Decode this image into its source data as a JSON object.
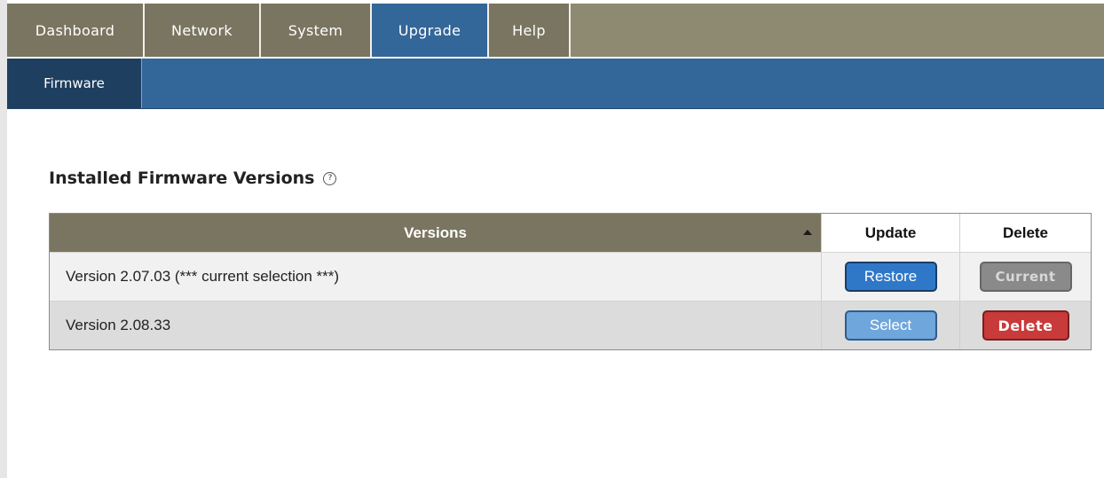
{
  "nav": {
    "tabs": [
      "Dashboard",
      "Network",
      "System",
      "Upgrade",
      "Help"
    ],
    "active": "Upgrade"
  },
  "subnav": {
    "tabs": [
      "Firmware"
    ]
  },
  "section": {
    "title": "Installed Firmware Versions",
    "help_icon": "help-icon",
    "help_glyph": "?"
  },
  "table": {
    "headers": {
      "versions": "Versions",
      "update": "Update",
      "delete": "Delete"
    },
    "sort": "ascending",
    "rows": [
      {
        "version": "Version 2.07.03 (*** current selection ***)",
        "update_label": "Restore",
        "delete_label": "Current"
      },
      {
        "version": "Version 2.08.33",
        "update_label": "Select",
        "delete_label": "Delete"
      }
    ]
  },
  "colors": {
    "nav_bg": "#8e8a72",
    "tab_bg": "#7a7560",
    "active_tab": "#336699",
    "subnav_bg": "#336699",
    "subnav_active": "#1f3f60",
    "restore_button": "#2f78c8",
    "select_button": "#6fa6dc",
    "current_button": "#8a8a8a",
    "delete_button": "#c93a3a"
  }
}
